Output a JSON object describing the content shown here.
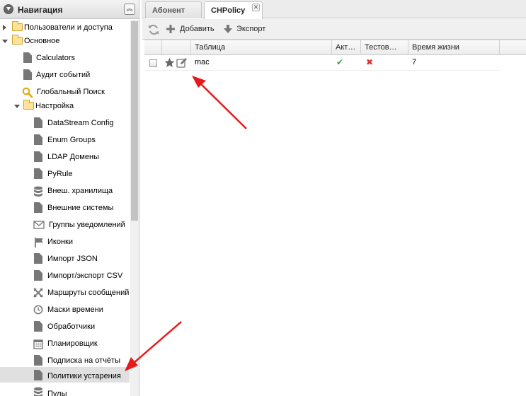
{
  "nav": {
    "title": "Навигация",
    "items": [
      {
        "label": "Пользователи и доступа"
      },
      {
        "label": "Основное"
      },
      {
        "label": "Calculators"
      },
      {
        "label": "Аудит событий"
      },
      {
        "label": "Глобальный Поиск"
      },
      {
        "label": "Настройка"
      },
      {
        "label": "DataStream Config"
      },
      {
        "label": "Enum Groups"
      },
      {
        "label": "LDAP Домены"
      },
      {
        "label": "PyRule"
      },
      {
        "label": "Внеш. хранилища"
      },
      {
        "label": "Внешние системы"
      },
      {
        "label": "Группы уведомлений"
      },
      {
        "label": "Иконки"
      },
      {
        "label": "Импорт JSON"
      },
      {
        "label": "Импорт/экспорт CSV"
      },
      {
        "label": "Маршруты сообщений"
      },
      {
        "label": "Маски времени"
      },
      {
        "label": "Обработчики"
      },
      {
        "label": "Планировщик"
      },
      {
        "label": "Подписка на отчёты"
      },
      {
        "label": "Политики устарения"
      },
      {
        "label": "Пулы"
      }
    ]
  },
  "tabs": [
    {
      "label": "Абонент"
    },
    {
      "label": "CHPolicy"
    }
  ],
  "toolbar": {
    "add_label": "Добавить",
    "export_label": "Экспорт"
  },
  "grid": {
    "columns": [
      "Таблица",
      "Акт…",
      "Тестов…",
      "Время жизни"
    ],
    "rows": [
      {
        "table": "mac",
        "active": true,
        "test": false,
        "ttl": "7"
      }
    ]
  },
  "colors": {
    "check": "#3aa53a",
    "cross": "#dd3333",
    "arrow": "#e8191a",
    "selected_row": "#e0e0e0"
  }
}
